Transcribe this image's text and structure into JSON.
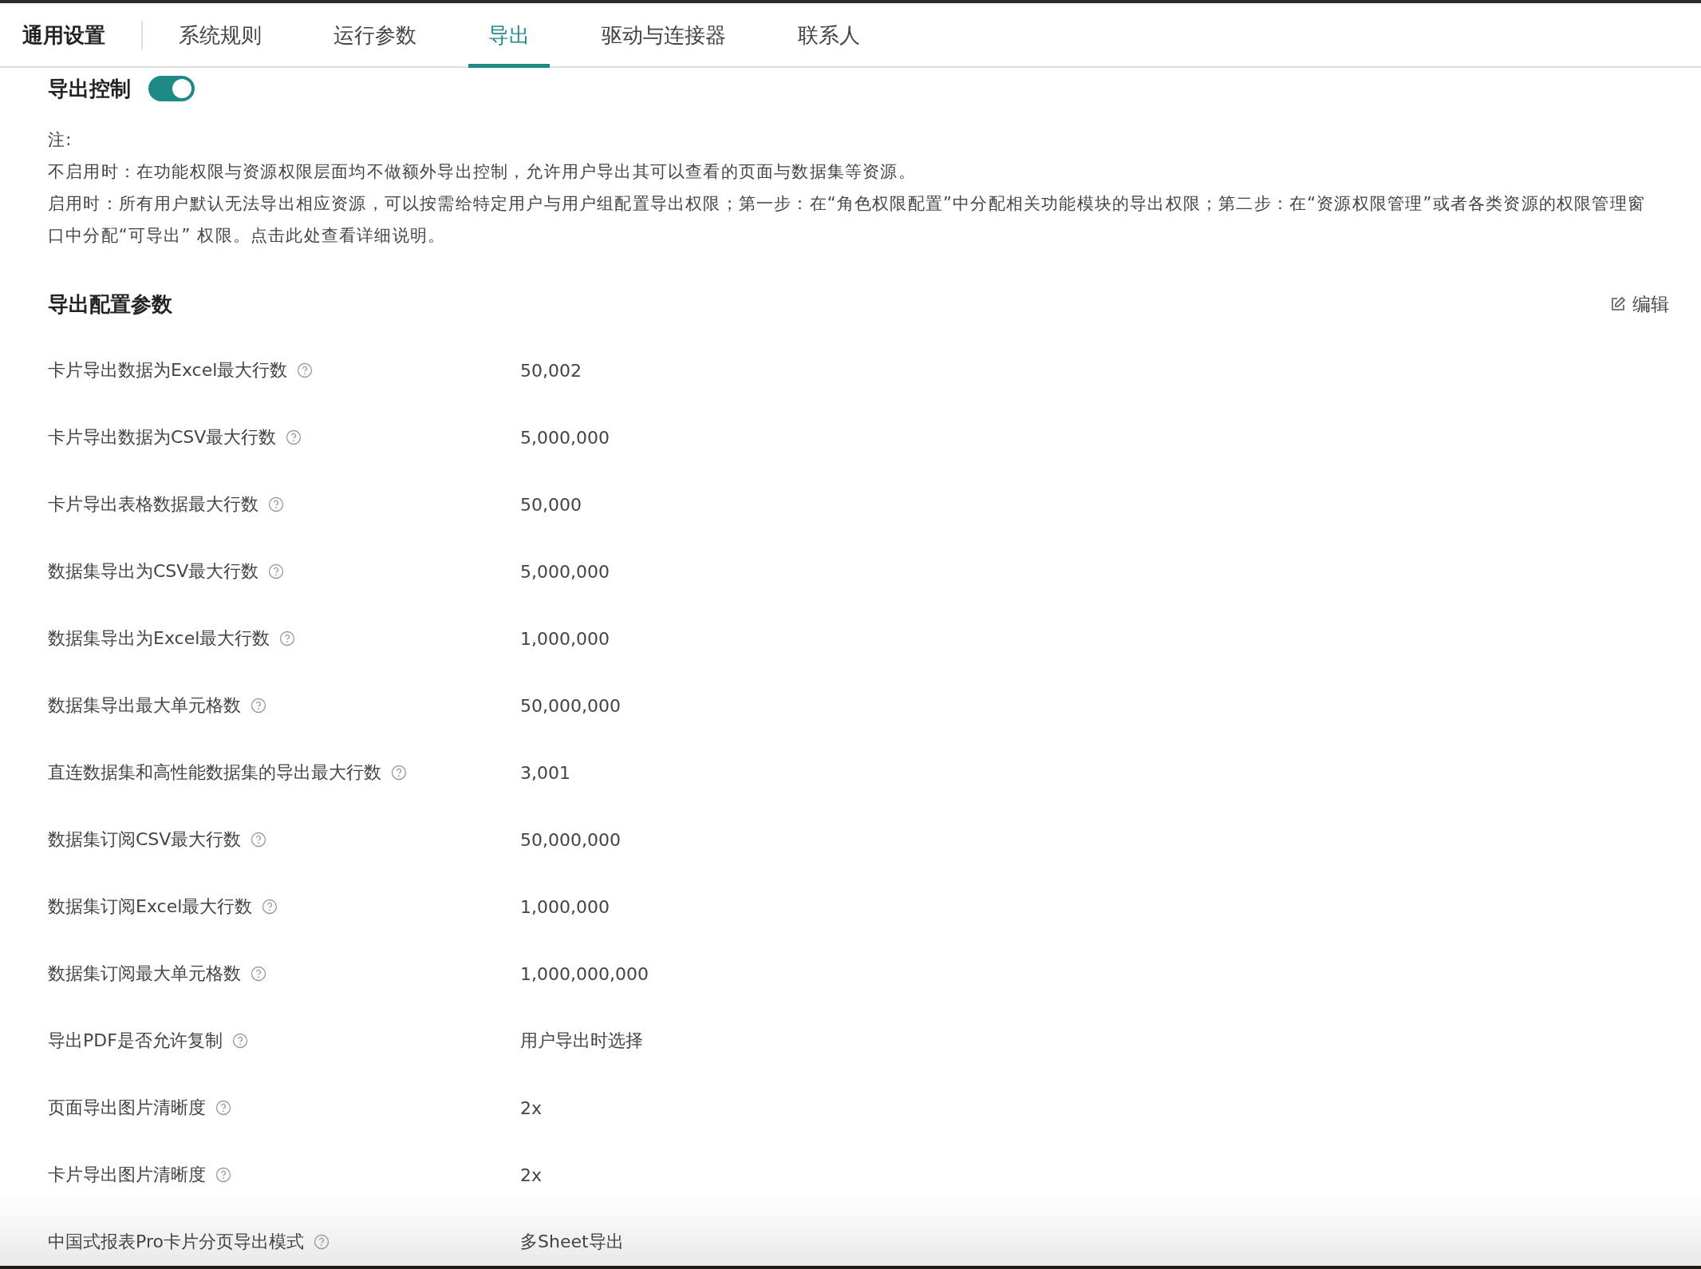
{
  "tabs": [
    {
      "label": "通用设置",
      "selected": false,
      "kind": "first"
    },
    {
      "label": "系统规则",
      "selected": false
    },
    {
      "label": "运行参数",
      "selected": false
    },
    {
      "label": "导出",
      "selected": true
    },
    {
      "label": "驱动与连接器",
      "selected": false
    },
    {
      "label": "联系人",
      "selected": false
    }
  ],
  "export_control": {
    "label": "导出控制",
    "on": true
  },
  "notes": [
    "注:",
    "不启用时：在功能权限与资源权限层面均不做额外导出控制，允许用户导出其可以查看的页面与数据集等资源。",
    "启用时：所有用户默认无法导出相应资源，可以按需给特定用户与用户组配置导出权限；第一步：在“角色权限配置”中分配相关功能模块的导出权限；第二步：在“资源权限管理”或者各类资源的权限管理窗口中分配“可导出” 权限。点击此处查看详细说明。"
  ],
  "section": {
    "title": "导出配置参数",
    "edit_button": "编辑"
  },
  "params": [
    {
      "label": "卡片导出数据为Excel最大行数",
      "value": "50,002"
    },
    {
      "label": "卡片导出数据为CSV最大行数",
      "value": "5,000,000"
    },
    {
      "label": "卡片导出表格数据最大行数",
      "value": "50,000"
    },
    {
      "label": "数据集导出为CSV最大行数",
      "value": "5,000,000"
    },
    {
      "label": "数据集导出为Excel最大行数",
      "value": "1,000,000"
    },
    {
      "label": "数据集导出最大单元格数",
      "value": "50,000,000"
    },
    {
      "label": "直连数据集和高性能数据集的导出最大行数",
      "value": "3,001"
    },
    {
      "label": "数据集订阅CSV最大行数",
      "value": "50,000,000"
    },
    {
      "label": "数据集订阅Excel最大行数",
      "value": "1,000,000"
    },
    {
      "label": "数据集订阅最大单元格数",
      "value": "1,000,000,000"
    },
    {
      "label": "导出PDF是否允许复制",
      "value": "用户导出时选择"
    },
    {
      "label": "页面导出图片清晰度",
      "value": "2x"
    },
    {
      "label": "卡片导出图片清晰度",
      "value": "2x"
    },
    {
      "label": "中国式报表Pro卡片分页导出模式",
      "value": "多Sheet导出"
    }
  ]
}
